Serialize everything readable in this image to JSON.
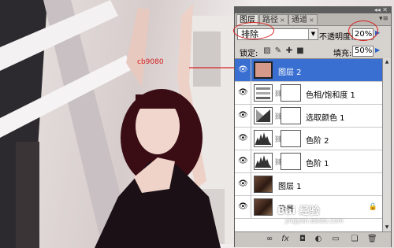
{
  "panel": {
    "tabs": [
      {
        "label": "图层",
        "active": true
      },
      {
        "label": "路径",
        "active": false
      },
      {
        "label": "通道",
        "active": false
      }
    ],
    "blend_mode": "排除",
    "opacity_label": "不透明度:",
    "opacity_value": "20%",
    "lock_label": "锁定:",
    "fill_label": "填充:",
    "fill_value": "50%",
    "layers": [
      {
        "name": "图层 2",
        "type": "fill",
        "selected": true,
        "visible": true
      },
      {
        "name": "色相/饱和度 1",
        "type": "adjustment",
        "selected": false,
        "visible": true
      },
      {
        "name": "选取颜色 1",
        "type": "adjustment",
        "selected": false,
        "visible": true
      },
      {
        "name": "色阶 2",
        "type": "adjustment",
        "selected": false,
        "visible": true
      },
      {
        "name": "色阶 1",
        "type": "adjustment",
        "selected": false,
        "visible": true
      },
      {
        "name": "图层 1",
        "type": "image",
        "selected": false,
        "visible": true
      },
      {
        "name": "背景",
        "type": "image",
        "selected": false,
        "visible": true,
        "locked": true
      }
    ],
    "bottom_icons": [
      "link-icon",
      "fx-icon",
      "mask-icon",
      "adjustment-icon",
      "folder-icon",
      "new-layer-icon",
      "trash-icon"
    ]
  },
  "annotation": {
    "color_code": "cb9080"
  },
  "watermark": {
    "brand": "Bai 经验",
    "url": "jingyan.baidu.com"
  },
  "colors": {
    "selection": "#3a6fd2",
    "fill_swatch": "#d79a8a",
    "annotation_red": "#d82020"
  }
}
